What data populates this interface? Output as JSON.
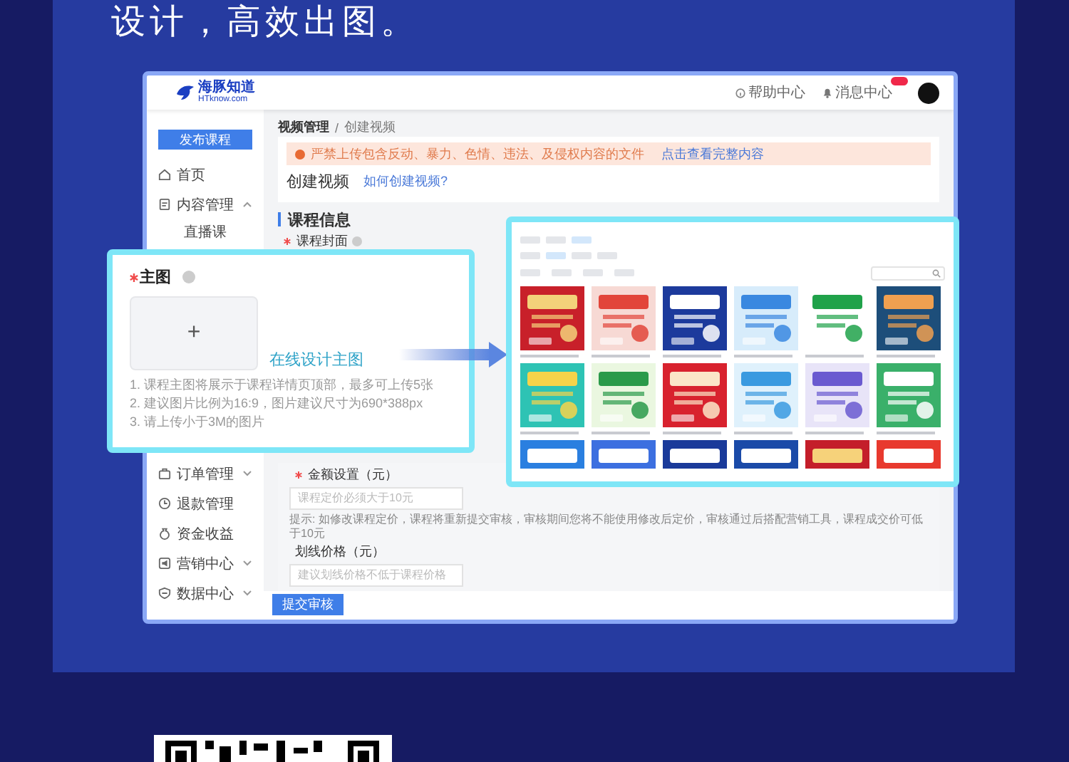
{
  "headline": "设计，高效出图。",
  "app": {
    "logo": {
      "name": "海豚知道",
      "domain": "HTknow.com"
    },
    "header_links": [
      {
        "kind": "help",
        "label": "帮助中心"
      },
      {
        "kind": "notifications",
        "label": "消息中心"
      }
    ],
    "sidebar": {
      "publish_button": "发布课程",
      "items": [
        {
          "kind": "home",
          "label": "首页"
        },
        {
          "kind": "content",
          "label": "内容管理",
          "expanded": true,
          "children": [
            {
              "label": "直播课"
            }
          ]
        },
        {
          "kind": "orders",
          "label": "订单管理",
          "expanded": false
        },
        {
          "kind": "refunds",
          "label": "退款管理"
        },
        {
          "kind": "income",
          "label": "资金收益"
        },
        {
          "kind": "marketing",
          "label": "营销中心",
          "expanded": false
        },
        {
          "kind": "data",
          "label": "数据中心",
          "expanded": false
        }
      ]
    },
    "breadcrumb": [
      "视频管理",
      "创建视频"
    ],
    "breadcrumb_separator": "/",
    "alert": {
      "message": "严禁上传包含反动、暴力、色情、违法、及侵权内容的文件",
      "link": "点击查看完整内容"
    },
    "page_title": "创建视频",
    "help_link": "如何创建视频?",
    "section_title": "课程信息",
    "cover_field": {
      "label": "课程封面",
      "required": true
    },
    "price_field": {
      "label": "金额设置（元）",
      "required": true,
      "placeholder": "课程定价必须大于10元"
    },
    "price_hint": "提示: 如修改课程定价，课程将重新提交审核，审核期间您将不能使用修改后定价，审核通过后搭配营销工具，课程成交价可低于10元",
    "strike_price_field": {
      "label": "划线价格（元）",
      "required": false,
      "placeholder": "建议划线价格不低于课程价格"
    },
    "submit_button": "提交审核"
  },
  "callout": {
    "label": "主图",
    "required": true,
    "upload_symbol": "+",
    "design_link": "在线设计主图",
    "notes": [
      "1. 课程主图将展示于课程详情页顶部，最多可上传5张",
      "2. 建议图片比例为16:9，图片建议尺寸为690*388px",
      "3. 请上传小于3M的图片"
    ]
  }
}
